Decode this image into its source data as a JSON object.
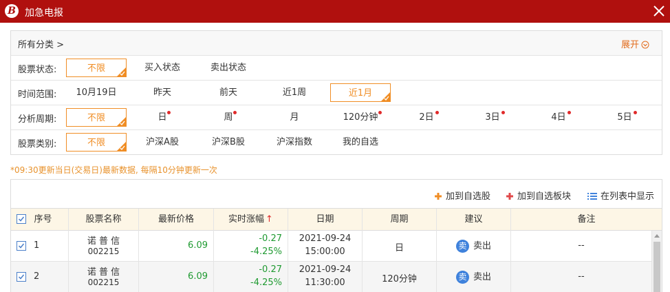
{
  "window": {
    "title": "加急电报"
  },
  "filters": {
    "breadcrumb": "所有分类 >",
    "expand_label": "展开",
    "rows": [
      {
        "label": "股票状态:",
        "options": [
          "不限",
          "买入状态",
          "卖出状态"
        ],
        "selected": 0
      },
      {
        "label": "时间范围:",
        "options": [
          "10月19日",
          "昨天",
          "前天",
          "近1周",
          "近1月"
        ],
        "selected": 4
      },
      {
        "label": "分析周期:",
        "options": [
          "不限",
          "日",
          "周",
          "月",
          "120分钟",
          "2日",
          "3日",
          "4日",
          "5日"
        ],
        "selected": 0
      },
      {
        "label": "股票类别:",
        "options": [
          "不限",
          "沪深A股",
          "沪深B股",
          "沪深指数",
          "我的自选"
        ],
        "selected": 0
      }
    ]
  },
  "notice": "*09:30更新当日(交易日)最新数据, 每隔10分钟更新一次",
  "toolbar": {
    "add_watchlist": "加到自选股",
    "add_block": "加到自选板块",
    "show_in_list": "在列表中显示"
  },
  "table": {
    "headers": [
      "序号",
      "股票名称",
      "最新价格",
      "实时涨幅",
      "日期",
      "周期",
      "建议",
      "备注"
    ],
    "sort_arrow": "↑",
    "rows": [
      {
        "index": "1",
        "name": "诺 普 信",
        "code": "002215",
        "price": "6.09",
        "change": "-0.27",
        "change_pct": "-4.25%",
        "date": "2021-09-24",
        "time": "15:00:00",
        "period": "日",
        "advice_badge": "卖",
        "advice": "卖出",
        "remark": "--"
      },
      {
        "index": "2",
        "name": "诺 普 信",
        "code": "002215",
        "price": "6.09",
        "change": "-0.27",
        "change_pct": "-4.25%",
        "date": "2021-09-24",
        "time": "11:30:00",
        "period": "120分钟",
        "advice_badge": "卖",
        "advice": "卖出",
        "remark": "--"
      }
    ]
  },
  "colors": {
    "titlebar": "#b0100e",
    "accent": "#f08d24",
    "positive": "#1f9a31",
    "badge": "#3f82dc"
  }
}
